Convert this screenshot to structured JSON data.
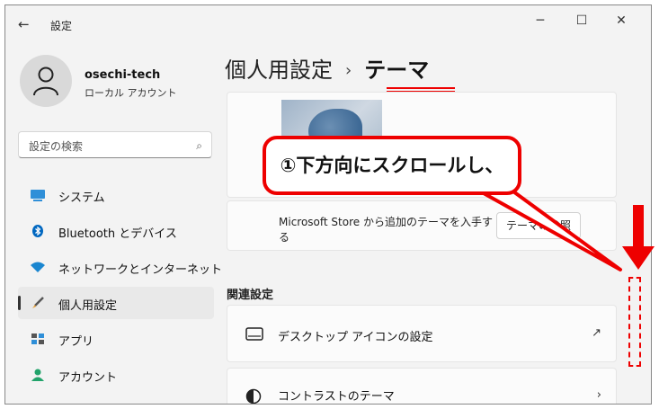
{
  "window": {
    "title": "設定",
    "back_icon": "arrow-left-icon",
    "minimize_glyph": "─",
    "maximize_glyph": "☐",
    "close_glyph": "✕"
  },
  "user": {
    "name": "osechi-tech",
    "account_type": "ローカル アカウント"
  },
  "search": {
    "placeholder": "設定の検索",
    "icon": "search-icon"
  },
  "sidebar": {
    "items": [
      {
        "label": "システム",
        "icon": "monitor-icon",
        "selected": false
      },
      {
        "label": "Bluetooth とデバイス",
        "icon": "bluetooth-icon",
        "selected": false
      },
      {
        "label": "ネットワークとインターネット",
        "icon": "wifi-icon",
        "selected": false
      },
      {
        "label": "個人用設定",
        "icon": "brush-icon",
        "selected": true
      },
      {
        "label": "アプリ",
        "icon": "apps-icon",
        "selected": false
      },
      {
        "label": "アカウント",
        "icon": "account-icon",
        "selected": false
      }
    ]
  },
  "breadcrumb": {
    "parent": "個人用設定",
    "separator": "›",
    "current": "テーマ"
  },
  "store": {
    "text": "Microsoft Store から追加のテーマを入手する",
    "button_label": "テーマの参照"
  },
  "related": {
    "heading": "関連設定",
    "rows": [
      {
        "label": "デスクトップ アイコンの設定",
        "trailing": "↗"
      },
      {
        "label": "コントラストのテーマ",
        "trailing": "›"
      }
    ]
  },
  "annotation": {
    "text": "①下方向にスクロールし、"
  },
  "colors": {
    "accent": "#0067c0",
    "annotation_red": "#e00000",
    "background": "#f3f3f3"
  }
}
